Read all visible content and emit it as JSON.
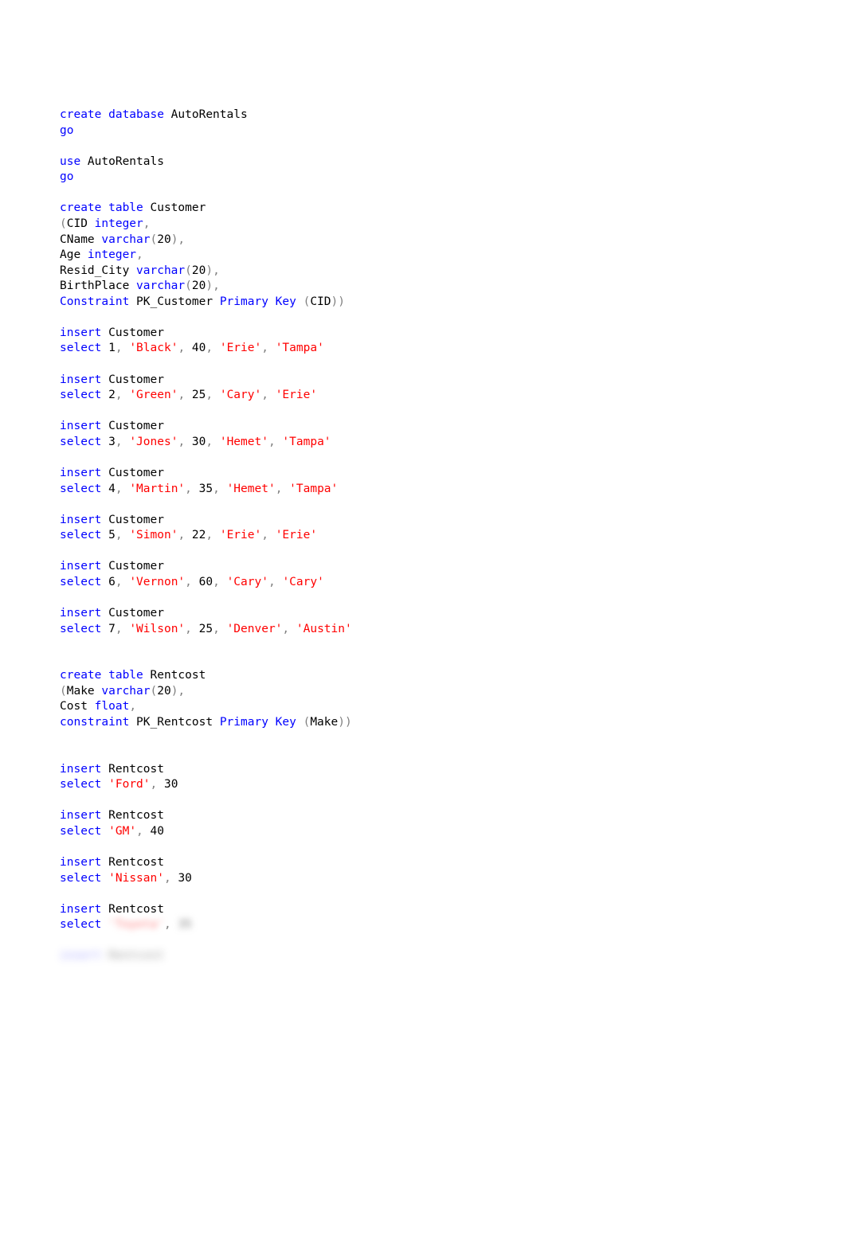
{
  "code": {
    "line01a": "create database",
    "line01b": " AutoRentals",
    "line02": "go",
    "line04a": "use",
    "line04b": " AutoRentals",
    "line05": "go",
    "line07a": "create table",
    "line07b": " Customer",
    "line08a": "(",
    "line08b": "CID ",
    "line08c": "integer",
    "line08d": ",",
    "line09a": "CName ",
    "line09b": "varchar",
    "line09c": "(",
    "line09d": "20",
    "line09e": "),",
    "line10a": "Age ",
    "line10b": "integer",
    "line10c": ",",
    "line11a": "Resid_City ",
    "line11b": "varchar",
    "line11c": "(",
    "line11d": "20",
    "line11e": "),",
    "line12a": "BirthPlace ",
    "line12b": "varchar",
    "line12c": "(",
    "line12d": "20",
    "line12e": "),",
    "line13a": "Constraint",
    "line13b": " PK_Customer ",
    "line13c": "Primary Key ",
    "line13d": "(",
    "line13e": "CID",
    "line13f": "))",
    "ins": "insert",
    "sel": "select",
    "cust": " Customer",
    "c1": " 1",
    "c2": " 2",
    "c3": " 3",
    "c4": " 4",
    "c5": " 5",
    "c6": " 6",
    "c7": " 7",
    "comma": ", ",
    "black": "'Black'",
    "green": "'Green'",
    "jones": "'Jones'",
    "martin": "'Martin'",
    "simon": "'Simon'",
    "vernon": "'Vernon'",
    "wilson": "'Wilson'",
    "n40": "40",
    "n25": "25",
    "n30": "30",
    "n35": "35",
    "n22": "22",
    "n60": "60",
    "erie": "'Erie'",
    "tampa": "'Tampa'",
    "cary": "'Cary'",
    "hemet": "'Hemet'",
    "denver": "'Denver'",
    "austin": "'Austin'",
    "rc_line1a": "create table",
    "rc_line1b": " Rentcost",
    "rc_line2a": "(",
    "rc_line2b": "Make ",
    "rc_line2c": "varchar",
    "rc_line2d": "(",
    "rc_line2e": "20",
    "rc_line2f": "),",
    "rc_line3a": "Cost ",
    "rc_line3b": "float",
    "rc_line3c": ",",
    "rc_line4a": "constraint",
    "rc_line4b": " PK_Rentcost ",
    "rc_line4c": "Primary Key ",
    "rc_line4d": "(",
    "rc_line4e": "Make",
    "rc_line4f": "))",
    "rentcost": " Rentcost",
    "sp": " ",
    "ford": "'Ford'",
    "gm": "'GM'",
    "nissan": "'Nissan'",
    "rn30": "30",
    "rn40": "40",
    "blur_str": "'Toyota'",
    "blur_num": "35",
    "blur_insert": "insert",
    "blur_rentcost": " Rentcost"
  }
}
